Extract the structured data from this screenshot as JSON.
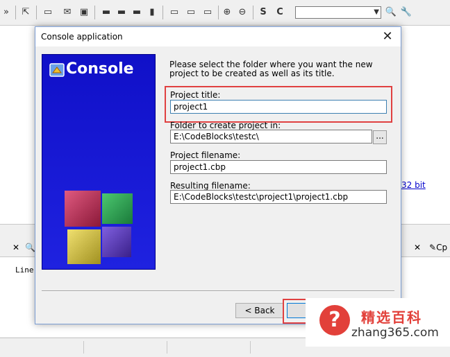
{
  "background": {
    "link_text": "32 bit",
    "log_text": "Line",
    "tab_right_label": "Cp"
  },
  "dialog": {
    "title": "Console application",
    "close_glyph": "✕",
    "banner_title": "Console",
    "intro": "Please select the folder where you want the new project to be created as well as its title.",
    "fields": {
      "project_title_label": "Project title:",
      "project_title_value": "project1",
      "folder_label": "Folder to create project in:",
      "folder_value": "E:\\CodeBlocks\\testc\\",
      "browse_label": "...",
      "filename_label": "Project filename:",
      "filename_value": "project1.cbp",
      "resulting_label": "Resulting filename:",
      "resulting_value": "E:\\CodeBlocks\\testc\\project1\\project1.cbp"
    },
    "buttons": {
      "back": "< Back",
      "next": "Ne"
    }
  },
  "watermark": {
    "badge": "?",
    "line1": "精选百科",
    "line2": "zhang365.com"
  },
  "colors": {
    "banner_blue": "#1414d0",
    "highlight_red": "#e04040",
    "watermark_red": "#e2403a"
  }
}
